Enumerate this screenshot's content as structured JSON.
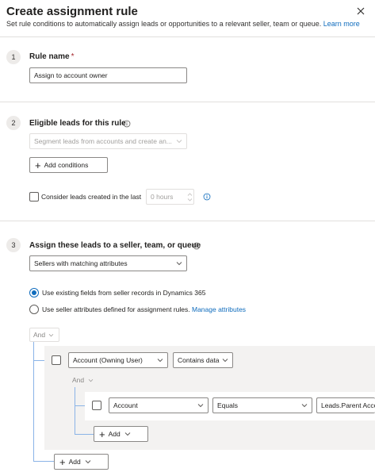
{
  "header": {
    "title": "Create assignment rule",
    "subtitle": "Set rule conditions to automatically assign leads or opportunities to a relevant seller, team or queue.",
    "learn_more": "Learn more",
    "close_icon": "close-icon"
  },
  "section1": {
    "number": "1",
    "label": "Rule name",
    "required_mark": "*",
    "value": "Assign to account owner"
  },
  "section2": {
    "number": "2",
    "label": "Eligible leads for this rule",
    "segment_placeholder": "Segment leads from accounts and create an...",
    "add_conditions": "Add conditions",
    "consider_label": "Consider leads created in the last",
    "hours_placeholder": "0 hours"
  },
  "section3": {
    "number": "3",
    "label": "Assign these leads to a seller, team, or queue",
    "seller_dropdown": "Sellers with matching attributes",
    "radio1": "Use existing fields from seller records in Dynamics 365",
    "radio2": "Use seller attributes defined for assignment rules.",
    "manage_attributes": "Manage attributes",
    "and_outer": "And",
    "condition1": {
      "field": "Account (Owning User)",
      "operator": "Contains data"
    },
    "and_inner": "And",
    "condition2": {
      "field": "Account",
      "operator": "Equals",
      "value": "Leads.Parent Account"
    },
    "add_inner": "Add",
    "add_outer": "Add"
  },
  "colors": {
    "accent": "#0f6cbd",
    "tree_line": "#8bb4e7",
    "panel": "#f3f2f1"
  }
}
